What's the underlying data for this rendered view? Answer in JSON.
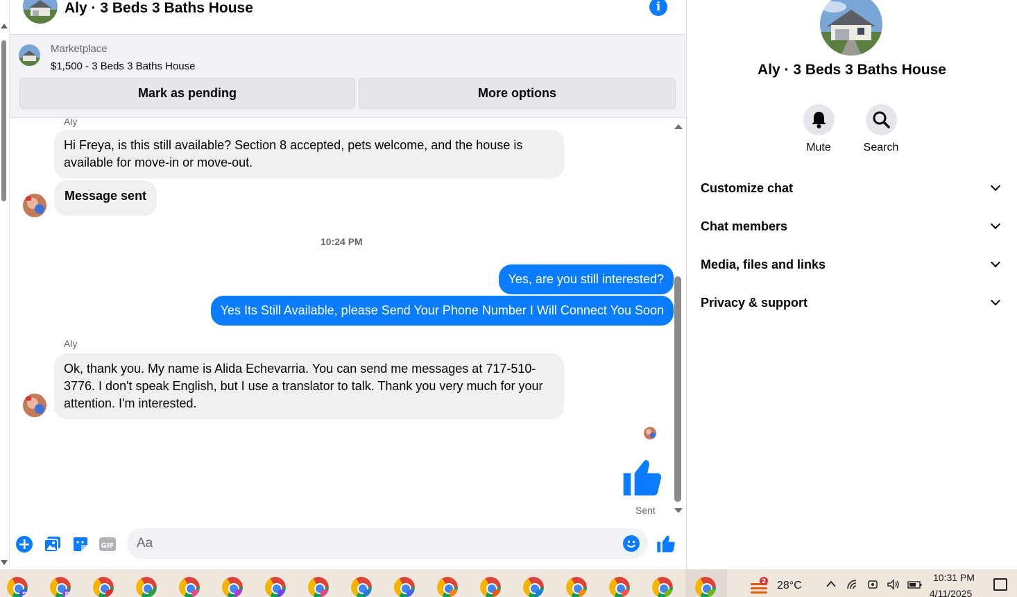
{
  "header": {
    "title": "Aly · 3 Beds 3 Baths House",
    "info_icon": "info-icon"
  },
  "marketplace": {
    "label": "Marketplace",
    "listing": "$1,500 - 3 Beds 3 Baths House",
    "pending_button": "Mark as pending",
    "more_button": "More options"
  },
  "messages": {
    "sender_1": "Aly",
    "msg_1": "Hi Freya, is this still available? Section 8 accepted, pets welcome, and the house is available for move-in or move-out.",
    "msg_2": "Message sent",
    "time_divider": "10:24 PM",
    "out_1": "Yes, are you still interested?",
    "out_2": "Yes Its Still Available, please Send Your Phone Number I Will Connect You Soon",
    "sender_2": "Aly",
    "msg_3": "Ok, thank you. My name is Alida Echevarria. You can send me messages at 717-510-3776. I don't speak English, but I use a translator to talk. Thank you very much for your attention. I'm interested.",
    "status": "Sent"
  },
  "composer": {
    "placeholder": "Aa"
  },
  "side": {
    "name": "Aly · 3 Beds 3 Baths House",
    "mute_label": "Mute",
    "search_label": "Search",
    "sections": [
      "Customize chat",
      "Chat members",
      "Media, files and links",
      "Privacy & support"
    ]
  },
  "taskbar": {
    "weather_badge": "2",
    "temperature": "28°C",
    "time": "10:31 PM",
    "date": "4/11/2025",
    "app_badges": [
      "S",
      "R",
      "",
      "",
      "",
      "",
      "",
      "",
      "",
      "",
      "",
      "",
      "",
      "",
      "",
      "",
      ""
    ],
    "badge_colors": [
      "#3b5bdb",
      "#7b4fc9",
      "#e03131",
      "#2f9e44",
      "#e64980",
      "#ae3ec9",
      "#7048e8",
      "#e64980",
      "#1c7ed6",
      "#4263eb",
      "#fd7e14",
      "#e8590c",
      "#1c7ed6",
      "#f08c00",
      "#fa5252",
      "#74b816",
      "#74b816"
    ]
  },
  "colors": {
    "accent": "#0a7cff",
    "bubble_in": "#f0f0f0",
    "panel_bg": "#f0f2f5"
  }
}
